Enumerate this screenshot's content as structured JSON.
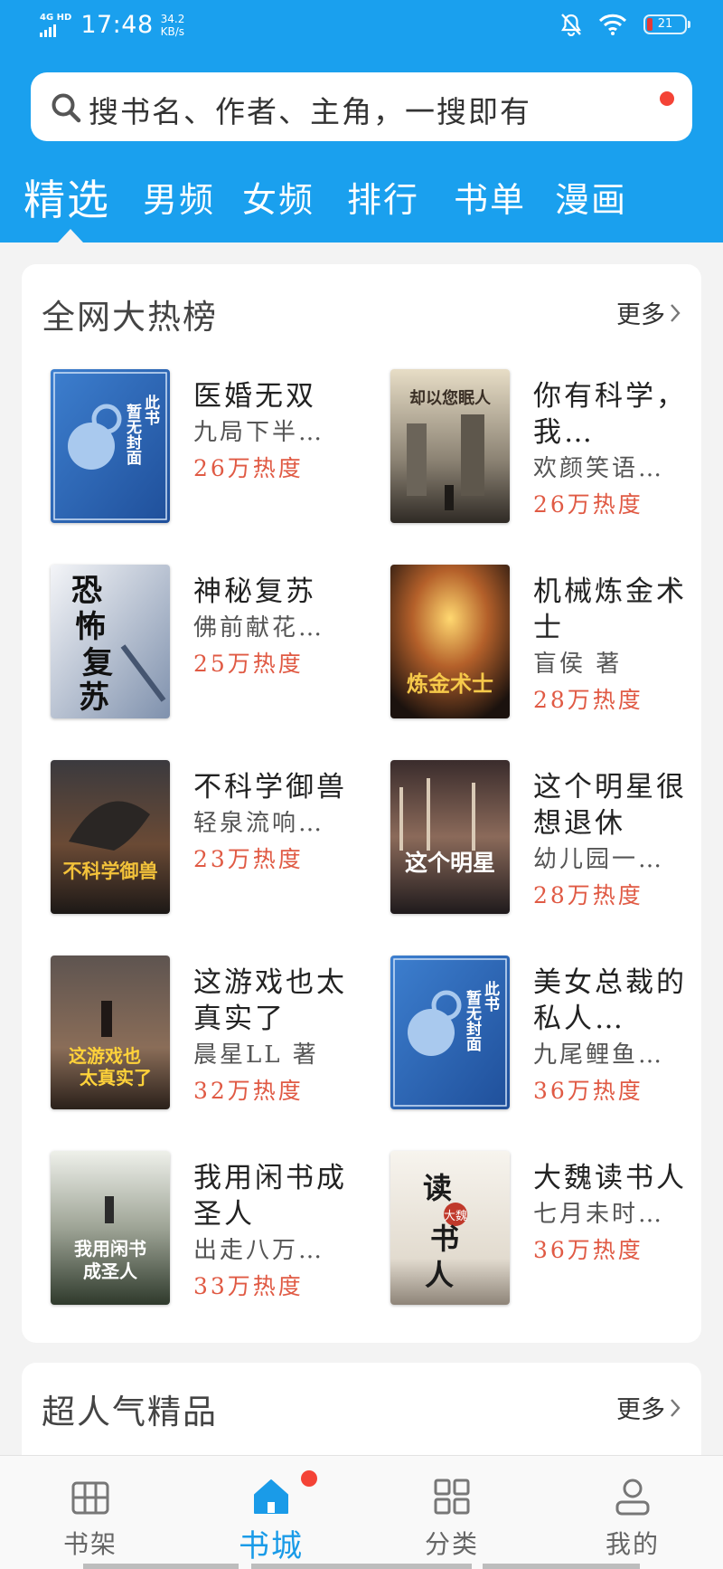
{
  "status_bar": {
    "network": "4G HD",
    "time": "17:48",
    "speed_value": "34.2",
    "speed_unit": "KB/s",
    "battery": "21"
  },
  "search": {
    "placeholder": "搜书名、作者、主角，一搜即有"
  },
  "tabs": [
    "精选",
    "男频",
    "女频",
    "排行",
    "书单",
    "漫画"
  ],
  "active_tab": "精选",
  "hot_section": {
    "title": "全网大热榜",
    "more_label": "更多",
    "books": [
      {
        "title": "医婚无双",
        "author": "九局下半…",
        "heat": "26万热度",
        "cover_text": "此书暂无封面"
      },
      {
        "title": "你有科学，我…",
        "author": "欢颜笑语…",
        "heat": "26万热度",
        "cover_text": "却以您眠人"
      },
      {
        "title": "神秘复苏",
        "author": "佛前献花…",
        "heat": "25万热度",
        "cover_text": "恐怖复苏"
      },
      {
        "title": "机械炼金术士",
        "author": "盲侯 著",
        "heat": "28万热度",
        "cover_text": "炼金术士"
      },
      {
        "title": "不科学御兽",
        "author": "轻泉流响…",
        "heat": "23万热度",
        "cover_text": "不科学御兽"
      },
      {
        "title": "这个明星很想退休",
        "author": "幼儿园一…",
        "heat": "28万热度",
        "cover_text": "这个明星"
      },
      {
        "title": "这游戏也太真实了",
        "author": "晨星LL 著",
        "heat": "32万热度",
        "cover_text": "这游戏也太真实了"
      },
      {
        "title": "美女总裁的私人…",
        "author": "九尾鲤鱼…",
        "heat": "36万热度",
        "cover_text": "此书暂无封面"
      },
      {
        "title": "我用闲书成圣人",
        "author": "出走八万…",
        "heat": "33万热度",
        "cover_text": "我用闲书成圣人"
      },
      {
        "title": "大魏读书人",
        "author": "七月未时…",
        "heat": "36万热度",
        "cover_text": "大魏读书人"
      }
    ]
  },
  "popular_section": {
    "title": "超人气精品",
    "more_label": "更多"
  },
  "bottom_nav": [
    {
      "label": "书架",
      "icon": "bookshelf-icon"
    },
    {
      "label": "书城",
      "icon": "home-icon"
    },
    {
      "label": "分类",
      "icon": "category-icon"
    },
    {
      "label": "我的",
      "icon": "profile-icon"
    }
  ],
  "colors": {
    "brand": "#1aa0ee",
    "heat": "#e05a44",
    "badge": "#f44336",
    "nav_active": "#1a9be8"
  }
}
